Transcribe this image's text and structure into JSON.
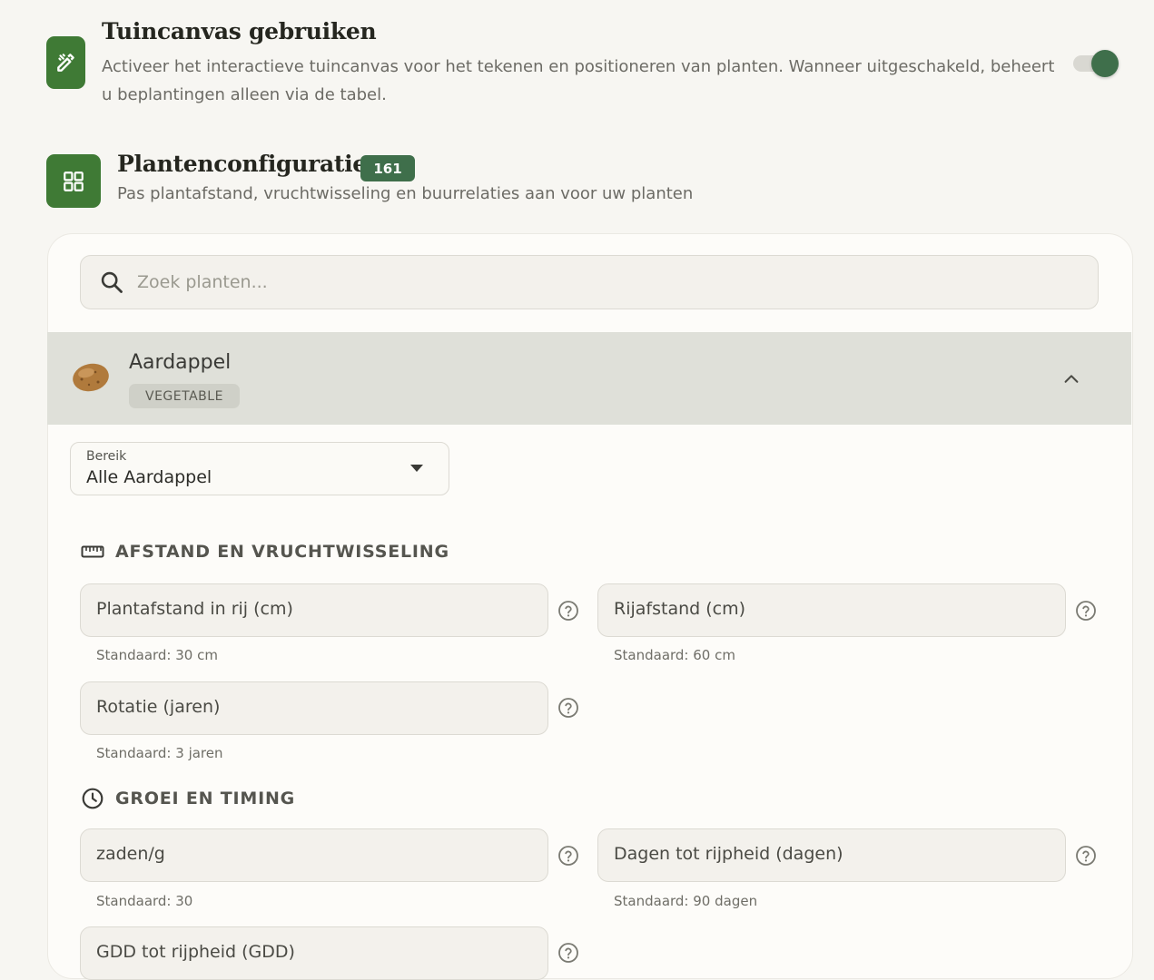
{
  "canvas_setting": {
    "title": "Tuincanvas gebruiken",
    "description": "Activeer het interactieve tuincanvas voor het tekenen en positioneren van planten. Wanneer uitgeschakeld, beheert u beplantingen alleen via de tabel.",
    "enabled": true,
    "icon": "pencil-ruler-icon"
  },
  "plant_config": {
    "title": "Plantenconfiguratie",
    "count": "161",
    "description": "Pas plantafstand, vruchtwisseling en buurrelaties aan voor uw planten",
    "icon": "grid-icon"
  },
  "search": {
    "placeholder": "Zoek planten..."
  },
  "plant": {
    "name": "Aardappel",
    "category": "VEGETABLE",
    "expanded": true
  },
  "scope": {
    "label": "Bereik",
    "value": "Alle Aardappel"
  },
  "sections": {
    "spacing": {
      "title": "AFSTAND EN VRUCHTWISSELING",
      "fields": [
        {
          "label": "Plantafstand in rij (cm)",
          "helper": "Standaard: 30 cm"
        },
        {
          "label": "Rijafstand (cm)",
          "helper": "Standaard: 60 cm"
        },
        {
          "label": "Rotatie (jaren)",
          "helper": "Standaard: 3 jaren"
        }
      ]
    },
    "growth": {
      "title": "GROEI EN TIMING",
      "fields": [
        {
          "label": "zaden/g",
          "helper": "Standaard: 30"
        },
        {
          "label": "Dagen tot rijpheid (dagen)",
          "helper": "Standaard: 90 dagen"
        },
        {
          "label": "GDD tot rijpheid (GDD)",
          "helper": ""
        }
      ]
    }
  },
  "colors": {
    "accent": "#3f6f4b",
    "icon_tile": "#3f7a35",
    "background": "#f7f6f2"
  }
}
